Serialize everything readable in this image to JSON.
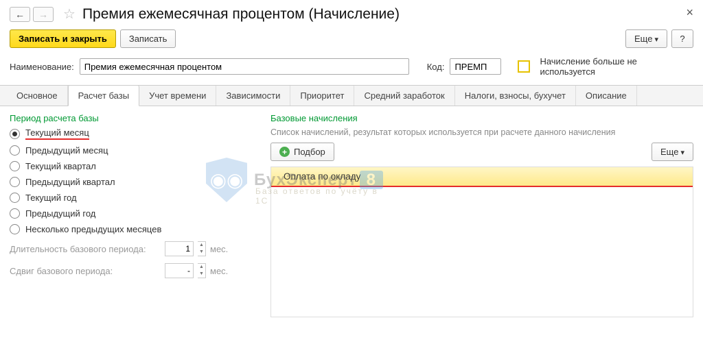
{
  "header": {
    "title": "Премия ежемесячная процентом (Начисление)"
  },
  "toolbar": {
    "save_close": "Записать и закрыть",
    "save": "Записать",
    "more": "Еще",
    "help": "?"
  },
  "form": {
    "name_label": "Наименование:",
    "name_value": "Премия ежемесячная процентом",
    "code_label": "Код:",
    "code_value": "ПРЕМП",
    "disabled_label": "Начисление больше не используется"
  },
  "tabs": [
    "Основное",
    "Расчет базы",
    "Учет времени",
    "Зависимости",
    "Приоритет",
    "Средний заработок",
    "Налоги, взносы, бухучет",
    "Описание"
  ],
  "active_tab": 1,
  "left": {
    "title": "Период расчета базы",
    "options": [
      "Текущий месяц",
      "Предыдущий месяц",
      "Текущий квартал",
      "Предыдущий квартал",
      "Текущий год",
      "Предыдущий год",
      "Несколько предыдущих месяцев"
    ],
    "selected": 0,
    "duration_label": "Длительность базового периода:",
    "duration_value": "1",
    "shift_label": "Сдвиг базового периода:",
    "shift_value": "-",
    "unit": "мес."
  },
  "right": {
    "title": "Базовые начисления",
    "desc": "Список начислений, результат которых используется при расчете данного начисления",
    "podbor": "Подбор",
    "more": "Еще",
    "rows": [
      "Оплата по окладу"
    ]
  },
  "watermark": {
    "main": "БухЭксперт",
    "eight": "8",
    "sub": "База ответов по учёту в 1С"
  }
}
